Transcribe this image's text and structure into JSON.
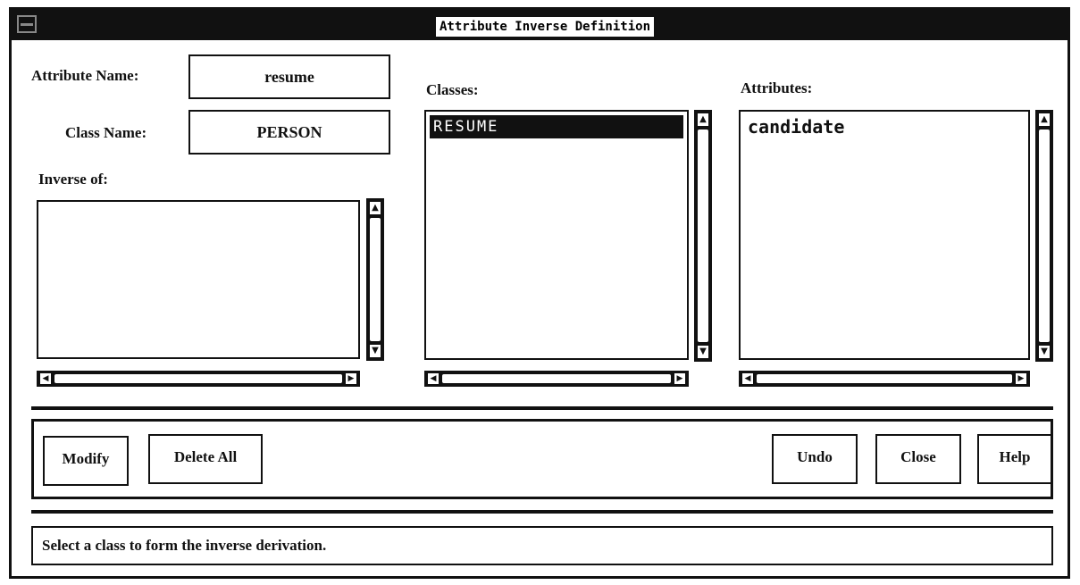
{
  "window": {
    "title": "Attribute Inverse Definition",
    "icons": {
      "system_menu": "system-menu-icon"
    }
  },
  "form": {
    "attribute_name_label": "Attribute Name:",
    "attribute_name_value": "resume",
    "class_name_label": "Class Name:",
    "class_name_value": "PERSON",
    "inverse_of_label": "Inverse of:"
  },
  "classes": {
    "label": "Classes:",
    "items": [
      "RESUME"
    ],
    "selected": "RESUME"
  },
  "attributes": {
    "label": "Attributes:",
    "items": [
      "candidate"
    ]
  },
  "buttons": {
    "modify": "Modify",
    "delete_all": "Delete All",
    "undo": "Undo",
    "close": "Close",
    "help": "Help"
  },
  "status": {
    "message": "Select a class to form the inverse derivation."
  },
  "scroll_icons": {
    "up": "▲",
    "down": "▼",
    "left": "◀",
    "right": "▶"
  }
}
